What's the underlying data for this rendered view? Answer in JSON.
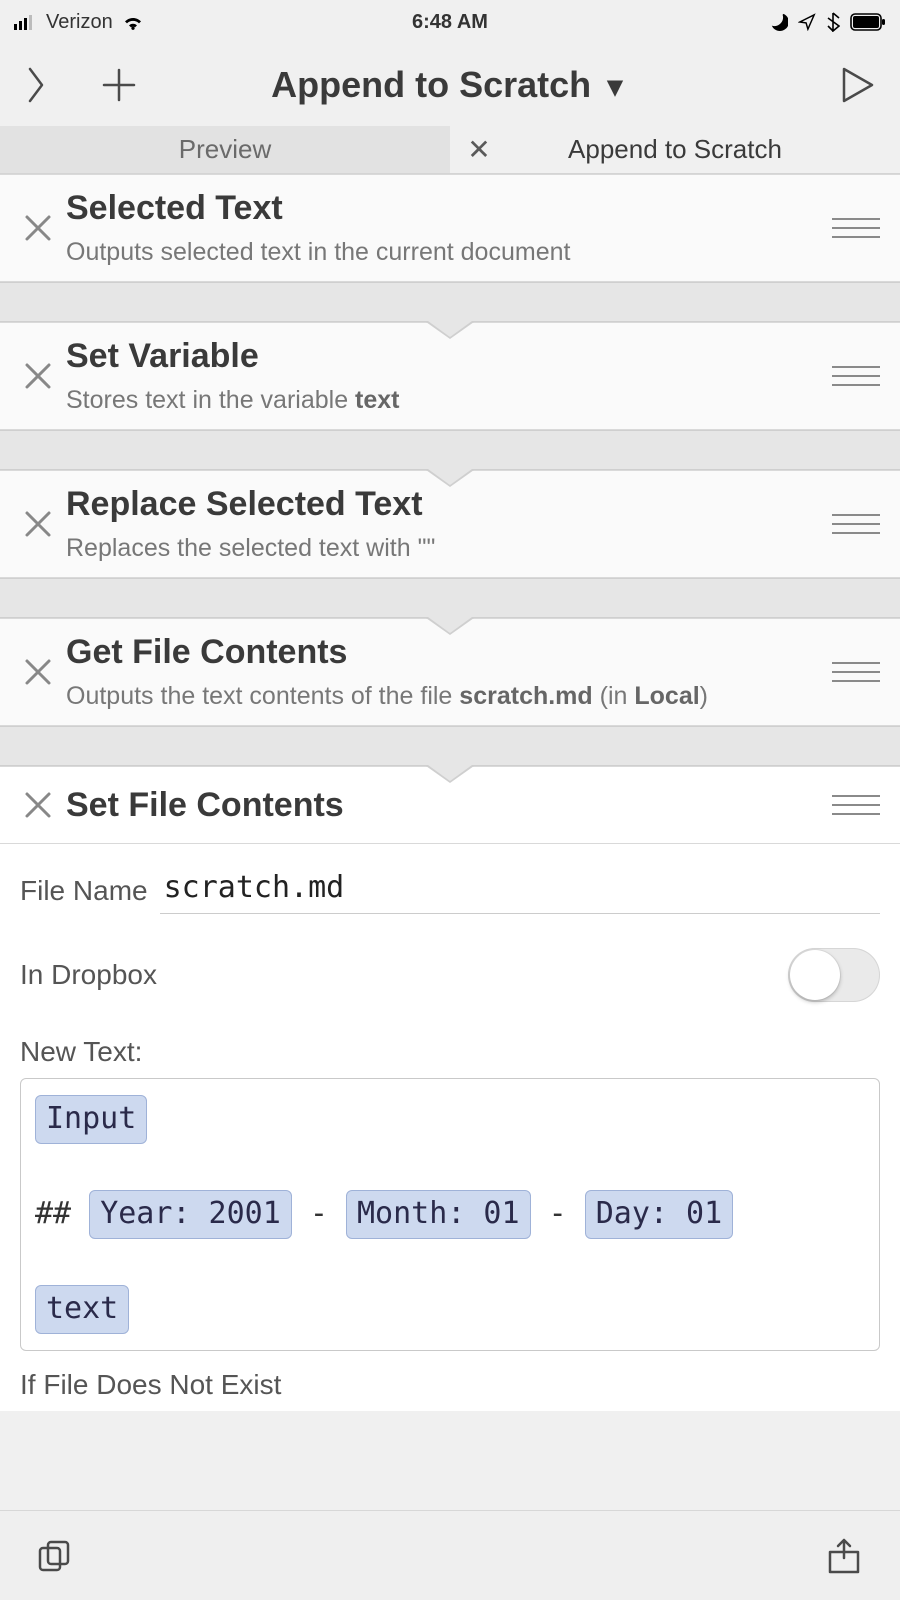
{
  "status": {
    "carrier": "Verizon",
    "time": "6:48 AM"
  },
  "nav": {
    "title": "Append to Scratch"
  },
  "tabs": {
    "preview": "Preview",
    "active": "Append to Scratch"
  },
  "steps": [
    {
      "title": "Selected Text",
      "subtitle_plain": "Outputs selected text in the current document"
    },
    {
      "title": "Set Variable",
      "subtitle_prefix": "Stores text in the variable ",
      "subtitle_em": "text"
    },
    {
      "title": "Replace Selected Text",
      "subtitle_plain": "Replaces the selected text with \"\""
    },
    {
      "title": "Get File Contents",
      "subtitle_prefix": "Outputs the text contents of the file ",
      "subtitle_em": "scratch.md",
      "subtitle_mid": " (in ",
      "subtitle_em2": "Local",
      "subtitle_suffix": ")"
    },
    {
      "title": "Set File Contents"
    }
  ],
  "detail": {
    "file_name_label": "File Name",
    "file_name_value": "scratch.md",
    "in_dropbox_label": "In Dropbox",
    "in_dropbox_on": false,
    "new_text_label": "New Text:",
    "template": {
      "token_input": "Input",
      "line2_prefix": "## ",
      "token_year": "Year: 2001",
      "sep": "-",
      "token_month": "Month: 01",
      "token_day": "Day: 01",
      "token_text": "text"
    },
    "if_label": "If File Does Not Exist"
  }
}
